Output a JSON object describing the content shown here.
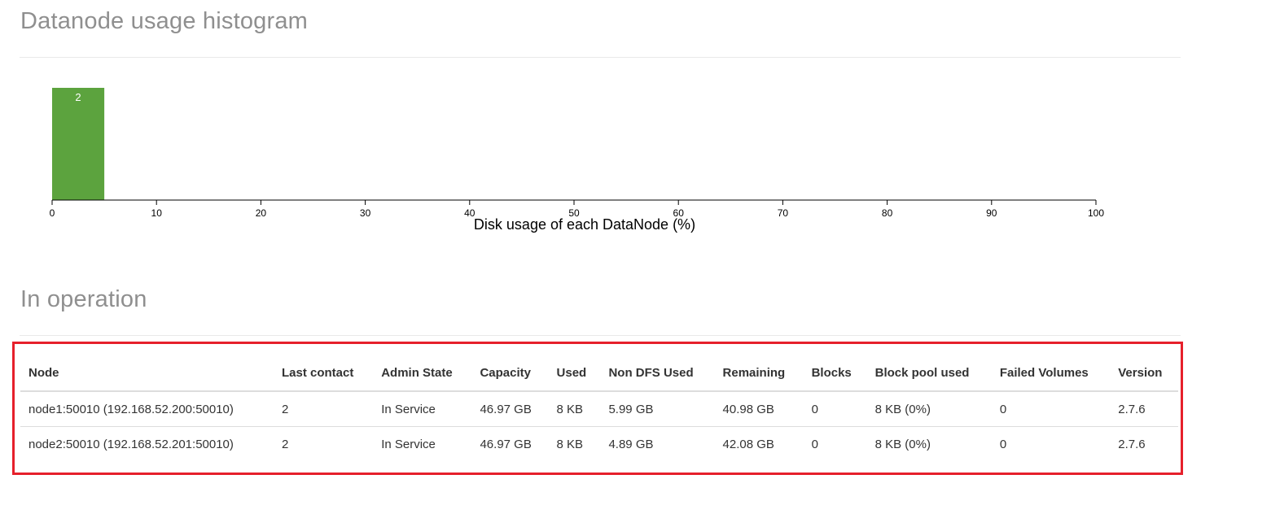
{
  "histogram_section": {
    "title": "Datanode usage histogram"
  },
  "operation_section": {
    "title": "In operation"
  },
  "chart_data": {
    "type": "bar",
    "bins": [
      {
        "x0": 0,
        "x1": 5,
        "count": 2,
        "label": "2"
      }
    ],
    "xlim": [
      0,
      100
    ],
    "xticks": [
      "0",
      "10",
      "20",
      "30",
      "40",
      "50",
      "60",
      "70",
      "80",
      "90",
      "100"
    ],
    "xlabel": "Disk usage of each DataNode (%)",
    "bar_color": "#5ca33e",
    "bar_label_color": "#ffffff",
    "grid": false
  },
  "table": {
    "columns": [
      "Node",
      "Last contact",
      "Admin State",
      "Capacity",
      "Used",
      "Non DFS Used",
      "Remaining",
      "Blocks",
      "Block pool used",
      "Failed Volumes",
      "Version"
    ],
    "rows": [
      [
        "node1:50010 (192.168.52.200:50010)",
        "2",
        "In Service",
        "46.97 GB",
        "8 KB",
        "5.99 GB",
        "40.98 GB",
        "0",
        "8 KB (0%)",
        "0",
        "2.7.6"
      ],
      [
        "node2:50010 (192.168.52.201:50010)",
        "2",
        "In Service",
        "46.97 GB",
        "8 KB",
        "4.89 GB",
        "42.08 GB",
        "0",
        "8 KB (0%)",
        "0",
        "2.7.6"
      ]
    ]
  },
  "colors": {
    "highlight_border": "#e6202b",
    "section_title": "#8f8f8f"
  }
}
